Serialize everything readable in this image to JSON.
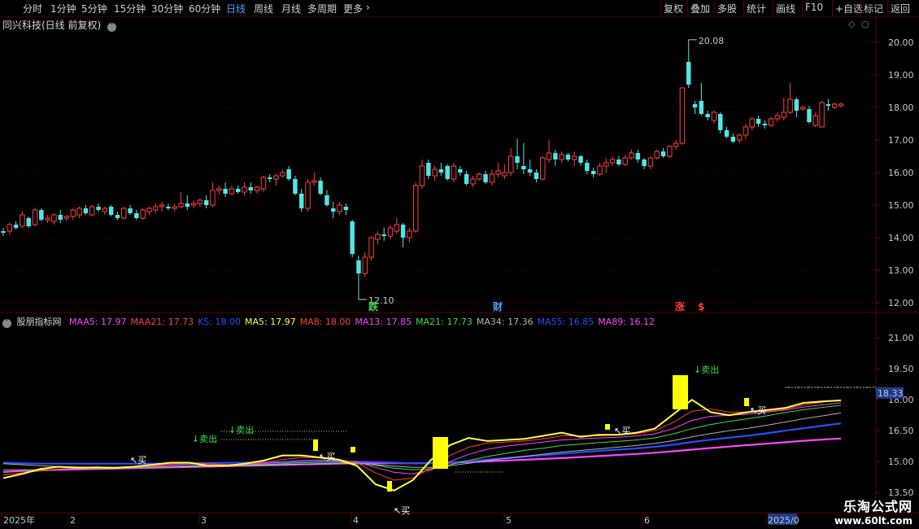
{
  "toolbar": {
    "periods": [
      "分时",
      "1分钟",
      "5分钟",
      "15分钟",
      "30分钟",
      "60分钟",
      "日线",
      "周线",
      "月线",
      "多周期",
      "更多"
    ],
    "active_period": "日线",
    "right_buttons": [
      "复权",
      "叠加",
      "多股",
      "统计",
      "画线",
      "F10",
      "+自选",
      "标记",
      "返回"
    ]
  },
  "main_chart": {
    "title": "同兴科技(日线 前复权)",
    "y_ticks": [
      "20.00",
      "19.00",
      "18.00",
      "17.00",
      "16.00",
      "15.00",
      "14.00",
      "13.00",
      "12.00"
    ],
    "high_label": "20.08",
    "low_label": "12.10",
    "markers": [
      {
        "text": "跌",
        "color": "#3ddc4a"
      },
      {
        "text": "财",
        "color": "#4aa3ff"
      },
      {
        "text": "涨",
        "color": "#ff4040"
      },
      {
        "text": "$",
        "color": "#ff4040"
      }
    ]
  },
  "indicator": {
    "name": "股朋指标网",
    "values": [
      {
        "label": "MAA5: 17.97",
        "color": "#ff44ff"
      },
      {
        "label": "MAA21: 17.73",
        "color": "#ff4040"
      },
      {
        "label": "KS: 18.00",
        "color": "#2a4cff"
      },
      {
        "label": "MA5: 17.97",
        "color": "#ffff40"
      },
      {
        "label": "MA8: 18.00",
        "color": "#ff4040"
      },
      {
        "label": "MA13: 17.85",
        "color": "#ff44ff"
      },
      {
        "label": "MA21: 17.73",
        "color": "#3ddc4a"
      },
      {
        "label": "MA34: 17.36",
        "color": "#b0b0b0"
      },
      {
        "label": "MA55: 16.85",
        "color": "#2a4cff"
      },
      {
        "label": "MA89: 16.12",
        "color": "#ff44ff"
      }
    ],
    "y_ticks": [
      "21.00",
      "19.50",
      "18.00",
      "16.50",
      "15.00",
      "13.50"
    ],
    "current_value": "18.33",
    "signals": [
      {
        "text": "卖出",
        "color": "#3ddc4a"
      },
      {
        "text": "卖出",
        "color": "#3ddc4a"
      },
      {
        "text": "卖出",
        "color": "#3ddc4a"
      },
      {
        "text": "买",
        "color": "#ffffff"
      },
      {
        "text": "买",
        "color": "#ffffff"
      },
      {
        "text": "买",
        "color": "#ffffff"
      },
      {
        "text": "买",
        "color": "#ffffff"
      },
      {
        "text": "买",
        "color": "#ffffff"
      }
    ]
  },
  "time_axis": {
    "labels": [
      "2025年",
      "2",
      "3",
      "4",
      "5",
      "6",
      "2025/0"
    ]
  },
  "watermark": {
    "title": "乐淘公式网",
    "url": "www.60lt.com"
  },
  "colors": {
    "up": "#ff4040",
    "down": "#50e6e6",
    "grid": "#5a0000",
    "axis_accent": "#4aa3ff"
  },
  "chart_data": {
    "type": "candlestick",
    "candles": [
      [
        14.2,
        14.3,
        14.05,
        14.15
      ],
      [
        14.2,
        14.45,
        14.1,
        14.4
      ],
      [
        14.4,
        14.5,
        14.25,
        14.3
      ],
      [
        14.35,
        14.8,
        14.3,
        14.7
      ],
      [
        14.6,
        14.65,
        14.3,
        14.35
      ],
      [
        14.4,
        14.9,
        14.35,
        14.85
      ],
      [
        14.85,
        14.9,
        14.5,
        14.55
      ],
      [
        14.55,
        14.7,
        14.45,
        14.6
      ],
      [
        14.5,
        14.75,
        14.4,
        14.7
      ],
      [
        14.7,
        14.85,
        14.45,
        14.55
      ],
      [
        14.6,
        14.7,
        14.5,
        14.65
      ],
      [
        14.65,
        14.9,
        14.55,
        14.85
      ],
      [
        14.7,
        14.95,
        14.6,
        14.9
      ],
      [
        14.9,
        15.0,
        14.7,
        14.75
      ],
      [
        14.7,
        15.0,
        14.65,
        14.95
      ],
      [
        14.95,
        15.05,
        14.8,
        14.85
      ],
      [
        14.8,
        14.95,
        14.7,
        14.9
      ],
      [
        14.95,
        15.0,
        14.65,
        14.7
      ],
      [
        14.7,
        14.8,
        14.55,
        14.6
      ],
      [
        14.6,
        14.95,
        14.55,
        14.9
      ],
      [
        14.9,
        15.0,
        14.7,
        14.75
      ],
      [
        14.75,
        14.85,
        14.55,
        14.6
      ],
      [
        14.6,
        14.9,
        14.55,
        14.85
      ],
      [
        14.8,
        14.95,
        14.7,
        14.9
      ],
      [
        14.85,
        15.05,
        14.75,
        14.95
      ],
      [
        14.95,
        15.1,
        14.8,
        15.0
      ],
      [
        14.95,
        15.05,
        14.85,
        14.9
      ],
      [
        14.9,
        15.05,
        14.8,
        14.95
      ],
      [
        14.95,
        15.4,
        14.9,
        15.05
      ],
      [
        15.05,
        15.3,
        14.85,
        14.95
      ],
      [
        15.0,
        15.15,
        14.9,
        15.05
      ],
      [
        15.05,
        15.2,
        14.95,
        15.15
      ],
      [
        15.15,
        15.3,
        14.9,
        15.0
      ],
      [
        15.0,
        15.7,
        14.95,
        15.45
      ],
      [
        15.45,
        15.6,
        15.3,
        15.5
      ],
      [
        15.5,
        15.7,
        15.25,
        15.35
      ],
      [
        15.35,
        15.6,
        15.3,
        15.5
      ],
      [
        15.5,
        15.6,
        15.35,
        15.4
      ],
      [
        15.4,
        15.7,
        15.3,
        15.55
      ],
      [
        15.55,
        15.7,
        15.35,
        15.45
      ],
      [
        15.45,
        15.6,
        15.35,
        15.55
      ],
      [
        15.5,
        15.9,
        15.4,
        15.85
      ],
      [
        15.85,
        15.95,
        15.7,
        15.8
      ],
      [
        15.8,
        15.95,
        15.6,
        15.9
      ],
      [
        15.9,
        16.1,
        15.85,
        16.0
      ],
      [
        16.1,
        16.2,
        15.75,
        15.8
      ],
      [
        15.8,
        15.9,
        15.3,
        15.35
      ],
      [
        15.35,
        15.5,
        14.8,
        14.9
      ],
      [
        14.9,
        15.8,
        14.8,
        15.7
      ],
      [
        15.7,
        16.0,
        15.6,
        15.75
      ],
      [
        15.75,
        15.85,
        15.3,
        15.35
      ],
      [
        15.3,
        15.45,
        14.95,
        15.0
      ],
      [
        14.9,
        15.1,
        14.6,
        14.8
      ],
      [
        14.8,
        15.1,
        14.7,
        15.0
      ],
      [
        14.95,
        15.05,
        14.7,
        14.85
      ],
      [
        14.5,
        14.55,
        13.4,
        13.5
      ],
      [
        13.3,
        13.45,
        12.1,
        12.9
      ],
      [
        12.9,
        13.55,
        12.8,
        13.4
      ],
      [
        13.4,
        14.05,
        13.3,
        14.0
      ],
      [
        13.95,
        14.2,
        13.8,
        14.1
      ],
      [
        14.1,
        14.3,
        13.9,
        14.05
      ],
      [
        14.05,
        14.4,
        13.95,
        14.3
      ],
      [
        14.2,
        14.6,
        14.1,
        14.4
      ],
      [
        14.4,
        14.45,
        13.7,
        14.0
      ],
      [
        14.0,
        14.3,
        13.85,
        14.2
      ],
      [
        14.2,
        15.7,
        14.15,
        15.6
      ],
      [
        15.6,
        16.4,
        15.5,
        16.2
      ],
      [
        16.3,
        16.4,
        15.8,
        15.9
      ],
      [
        15.9,
        16.2,
        15.75,
        16.1
      ],
      [
        16.1,
        16.3,
        15.9,
        16.0
      ],
      [
        16.2,
        16.25,
        15.75,
        15.8
      ],
      [
        15.8,
        16.3,
        15.7,
        16.2
      ],
      [
        16.1,
        16.2,
        15.9,
        16.0
      ],
      [
        15.95,
        16.05,
        15.6,
        15.65
      ],
      [
        15.65,
        15.9,
        15.55,
        15.8
      ],
      [
        15.8,
        16.0,
        15.75,
        15.95
      ],
      [
        15.95,
        16.05,
        15.65,
        15.7
      ],
      [
        15.7,
        16.1,
        15.6,
        15.95
      ],
      [
        15.95,
        16.3,
        15.85,
        16.05
      ],
      [
        15.9,
        16.25,
        15.8,
        16.0
      ],
      [
        16.0,
        16.75,
        15.9,
        16.5
      ],
      [
        16.5,
        17.05,
        16.1,
        16.3
      ],
      [
        16.2,
        16.9,
        15.95,
        16.1
      ],
      [
        16.1,
        16.4,
        15.9,
        16.0
      ],
      [
        16.0,
        16.1,
        15.7,
        15.8
      ],
      [
        15.8,
        16.5,
        15.75,
        16.45
      ],
      [
        16.4,
        17.0,
        16.3,
        16.6
      ],
      [
        16.6,
        16.7,
        16.2,
        16.4
      ],
      [
        16.4,
        16.65,
        16.3,
        16.55
      ],
      [
        16.55,
        16.6,
        16.35,
        16.4
      ],
      [
        16.4,
        16.65,
        16.2,
        16.5
      ],
      [
        16.5,
        16.55,
        16.2,
        16.3
      ],
      [
        16.3,
        16.4,
        15.95,
        16.05
      ],
      [
        16.05,
        16.15,
        15.85,
        15.95
      ],
      [
        15.95,
        16.3,
        15.9,
        16.2
      ],
      [
        16.2,
        16.45,
        16.0,
        16.3
      ],
      [
        16.3,
        16.5,
        16.2,
        16.4
      ],
      [
        16.4,
        16.5,
        16.2,
        16.25
      ],
      [
        16.25,
        16.55,
        16.2,
        16.45
      ],
      [
        16.45,
        16.7,
        16.4,
        16.6
      ],
      [
        16.6,
        16.7,
        16.3,
        16.4
      ],
      [
        16.4,
        16.45,
        16.1,
        16.2
      ],
      [
        16.2,
        16.5,
        16.1,
        16.45
      ],
      [
        16.45,
        16.7,
        16.4,
        16.65
      ],
      [
        16.65,
        16.75,
        16.45,
        16.5
      ],
      [
        16.5,
        16.85,
        16.45,
        16.8
      ],
      [
        16.8,
        17.0,
        16.7,
        16.9
      ],
      [
        16.9,
        18.6,
        16.85,
        18.6
      ],
      [
        19.4,
        20.08,
        18.6,
        18.7
      ],
      [
        18.1,
        18.2,
        17.8,
        18.0
      ],
      [
        18.2,
        18.75,
        17.75,
        17.8
      ],
      [
        17.8,
        17.9,
        17.6,
        17.7
      ],
      [
        17.6,
        17.9,
        17.5,
        17.85
      ],
      [
        17.8,
        17.85,
        17.2,
        17.3
      ],
      [
        17.3,
        17.4,
        17.05,
        17.1
      ],
      [
        17.1,
        17.2,
        16.9,
        16.95
      ],
      [
        17.0,
        17.2,
        16.9,
        17.15
      ],
      [
        17.15,
        17.5,
        17.05,
        17.4
      ],
      [
        17.4,
        17.7,
        17.3,
        17.65
      ],
      [
        17.65,
        17.75,
        17.4,
        17.5
      ],
      [
        17.5,
        17.6,
        17.35,
        17.45
      ],
      [
        17.45,
        17.7,
        17.4,
        17.65
      ],
      [
        17.65,
        17.85,
        17.55,
        17.75
      ],
      [
        17.7,
        18.3,
        17.6,
        17.85
      ],
      [
        17.85,
        18.75,
        17.8,
        18.25
      ],
      [
        18.25,
        18.3,
        17.7,
        17.9
      ],
      [
        17.95,
        18.05,
        17.9,
        18.0
      ],
      [
        17.95,
        18.05,
        17.5,
        17.55
      ],
      [
        17.45,
        17.85,
        17.4,
        17.75
      ],
      [
        17.4,
        18.2,
        17.4,
        18.15
      ],
      [
        18.1,
        18.25,
        17.9,
        18.05
      ],
      [
        18.0,
        18.15,
        17.95,
        18.1
      ],
      [
        18.05,
        18.15,
        18.0,
        18.1
      ]
    ],
    "y_range": [
      11.8,
      20.4
    ],
    "indicator_lines": {
      "MA5": [
        14.2,
        14.4,
        14.65,
        14.75,
        14.7,
        14.72,
        14.7,
        14.75,
        14.85,
        14.95,
        14.95,
        14.8,
        14.8,
        14.9,
        15.05,
        15.3,
        15.3,
        15.2,
        15.1,
        14.8,
        13.9,
        13.6,
        14.1,
        15.1,
        15.8,
        16.15,
        16.0,
        16.05,
        16.1,
        16.25,
        16.4,
        16.2,
        16.3,
        16.3,
        16.4,
        16.6,
        17.3,
        18.0,
        17.4,
        17.25,
        17.4,
        17.5,
        17.6,
        17.85,
        17.92,
        17.97
      ],
      "MA8": [
        14.35,
        14.45,
        14.55,
        14.65,
        14.68,
        14.7,
        14.72,
        14.75,
        14.8,
        14.88,
        14.95,
        14.9,
        14.85,
        14.88,
        14.95,
        15.1,
        15.2,
        15.18,
        15.12,
        14.95,
        14.45,
        14.1,
        14.2,
        14.7,
        15.3,
        15.7,
        15.9,
        15.95,
        16.0,
        16.1,
        16.25,
        16.25,
        16.25,
        16.3,
        16.35,
        16.5,
        16.9,
        17.45,
        17.55,
        17.4,
        17.4,
        17.45,
        17.55,
        17.75,
        17.88,
        18.0
      ],
      "MA13": [
        14.5,
        14.55,
        14.55,
        14.6,
        14.65,
        14.68,
        14.7,
        14.72,
        14.76,
        14.82,
        14.88,
        14.88,
        14.86,
        14.86,
        14.9,
        14.98,
        15.06,
        15.08,
        15.05,
        14.98,
        14.72,
        14.48,
        14.4,
        14.6,
        15.0,
        15.35,
        15.6,
        15.75,
        15.85,
        15.95,
        16.05,
        16.1,
        16.15,
        16.18,
        16.25,
        16.35,
        16.6,
        17.0,
        17.2,
        17.25,
        17.3,
        17.4,
        17.5,
        17.65,
        17.75,
        17.85
      ],
      "MA21": [
        14.6,
        14.6,
        14.6,
        14.62,
        14.64,
        14.66,
        14.68,
        14.7,
        14.72,
        14.76,
        14.8,
        14.82,
        14.83,
        14.84,
        14.86,
        14.9,
        14.95,
        14.98,
        14.98,
        14.95,
        14.82,
        14.68,
        14.6,
        14.65,
        14.85,
        15.05,
        15.25,
        15.4,
        15.55,
        15.65,
        15.78,
        15.85,
        15.92,
        15.98,
        16.05,
        16.15,
        16.35,
        16.6,
        16.8,
        16.95,
        17.08,
        17.22,
        17.38,
        17.52,
        17.63,
        17.73
      ],
      "MA34": [
        14.9,
        14.85,
        14.8,
        14.76,
        14.74,
        14.72,
        14.72,
        14.72,
        14.73,
        14.75,
        14.77,
        14.79,
        14.8,
        14.81,
        14.83,
        14.85,
        14.88,
        14.9,
        14.91,
        14.9,
        14.85,
        14.78,
        14.72,
        14.72,
        14.8,
        14.92,
        15.05,
        15.15,
        15.26,
        15.36,
        15.46,
        15.54,
        15.62,
        15.7,
        15.78,
        15.88,
        16.02,
        16.2,
        16.36,
        16.5,
        16.62,
        16.76,
        16.92,
        17.08,
        17.22,
        17.36
      ],
      "MA55": [
        14.95,
        14.92,
        14.9,
        14.9,
        14.9,
        14.9,
        14.9,
        14.9,
        14.9,
        14.91,
        14.92,
        14.93,
        14.94,
        14.95,
        14.96,
        14.97,
        14.98,
        14.99,
        15.0,
        15.0,
        14.98,
        14.95,
        14.92,
        14.92,
        14.96,
        15.02,
        15.1,
        15.17,
        15.24,
        15.31,
        15.38,
        15.45,
        15.52,
        15.58,
        15.64,
        15.72,
        15.82,
        15.95,
        16.06,
        16.16,
        16.26,
        16.37,
        16.5,
        16.62,
        16.74,
        16.85
      ],
      "MA89": [
        14.5,
        14.55,
        14.58,
        14.6,
        14.62,
        14.64,
        14.66,
        14.68,
        14.7,
        14.72,
        14.74,
        14.76,
        14.78,
        14.8,
        14.82,
        14.84,
        14.86,
        14.88,
        14.9,
        14.92,
        14.92,
        14.92,
        14.92,
        14.93,
        14.95,
        14.98,
        15.01,
        15.05,
        15.09,
        15.13,
        15.17,
        15.22,
        15.27,
        15.32,
        15.37,
        15.43,
        15.5,
        15.58,
        15.66,
        15.73,
        15.8,
        15.87,
        15.94,
        16.01,
        16.07,
        16.12
      ]
    },
    "indicator_y_range": [
      12.6,
      21.6
    ]
  }
}
